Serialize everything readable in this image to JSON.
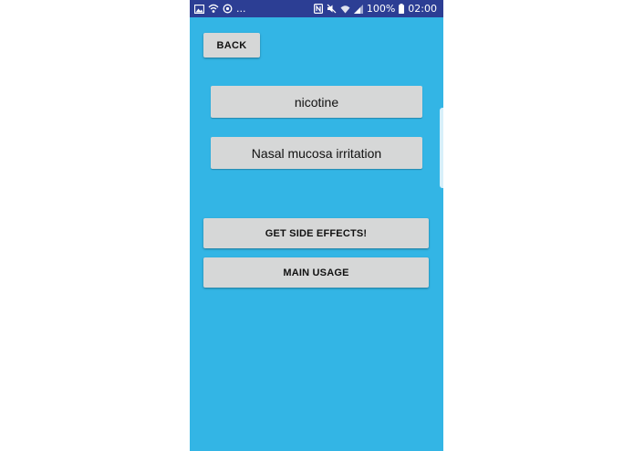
{
  "status_bar": {
    "left_icons": [
      "image-icon",
      "wifi-hotspot-icon",
      "sync-icon"
    ],
    "overflow_text": "...",
    "right_icons": [
      "nfc-icon",
      "mute-icon",
      "wifi-icon",
      "signal-icon"
    ],
    "battery_text": "100%",
    "time": "02:00"
  },
  "screen": {
    "background_color": "#33b5e5",
    "back_button_label": "BACK",
    "drug_field_value": "nicotine",
    "side_effect_field_value": "Nasal mucosa irritation",
    "get_side_effects_label": "GET SIDE EFFECTS!",
    "main_usage_label": "MAIN USAGE"
  }
}
